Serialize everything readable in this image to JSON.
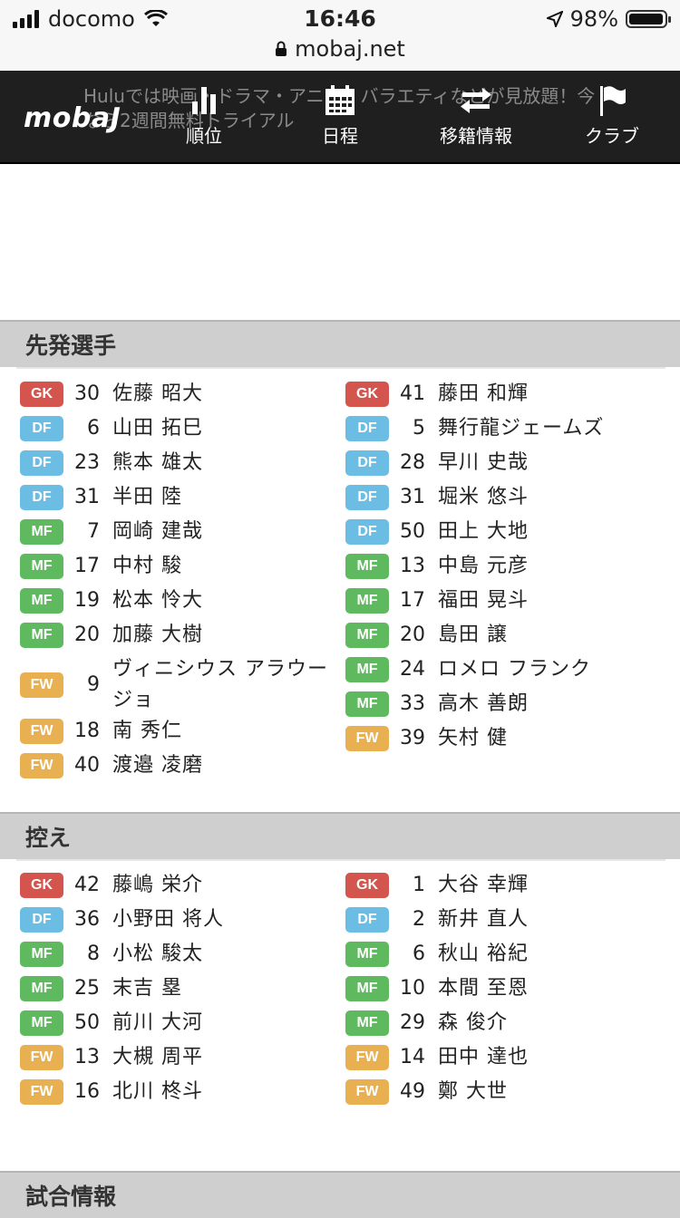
{
  "status_bar": {
    "carrier": "docomo",
    "time": "16:46",
    "battery": "98%",
    "battery_level": 0.98,
    "url": "mobaj.net"
  },
  "nav": {
    "logo": "mobaJ",
    "ghost_ad_line1": "Huluでは映画・ドラマ・アニメ・バラエティなどが見放題！今",
    "ghost_ad_line2": "なら2週間無料トライアル",
    "items": [
      {
        "label": "順位",
        "icon": "bar-chart-icon"
      },
      {
        "label": "日程",
        "icon": "calendar-icon"
      },
      {
        "label": "移籍情報",
        "icon": "transfer-arrows-icon"
      },
      {
        "label": "クラブ",
        "icon": "flag-icon"
      }
    ]
  },
  "position_colors": {
    "GK": "#d3554e",
    "DF": "#6bbde3",
    "MF": "#5fba5f",
    "FW": "#e8b050"
  },
  "starters": {
    "title": "先発選手",
    "left": [
      {
        "pos": "GK",
        "num": "30",
        "name": "佐藤 昭大"
      },
      {
        "pos": "DF",
        "num": "6",
        "name": "山田 拓巳"
      },
      {
        "pos": "DF",
        "num": "23",
        "name": "熊本 雄太"
      },
      {
        "pos": "DF",
        "num": "31",
        "name": "半田 陸"
      },
      {
        "pos": "MF",
        "num": "7",
        "name": "岡崎 建哉"
      },
      {
        "pos": "MF",
        "num": "17",
        "name": "中村 駿"
      },
      {
        "pos": "MF",
        "num": "19",
        "name": "松本 怜大"
      },
      {
        "pos": "MF",
        "num": "20",
        "name": "加藤 大樹"
      },
      {
        "pos": "FW",
        "num": "9",
        "name": "ヴィニシウス アラウージョ"
      },
      {
        "pos": "FW",
        "num": "18",
        "name": "南 秀仁"
      },
      {
        "pos": "FW",
        "num": "40",
        "name": "渡邉 凌磨"
      }
    ],
    "right": [
      {
        "pos": "GK",
        "num": "41",
        "name": "藤田 和輝"
      },
      {
        "pos": "DF",
        "num": "5",
        "name": "舞行龍ジェームズ"
      },
      {
        "pos": "DF",
        "num": "28",
        "name": "早川 史哉"
      },
      {
        "pos": "DF",
        "num": "31",
        "name": "堀米 悠斗"
      },
      {
        "pos": "DF",
        "num": "50",
        "name": "田上 大地"
      },
      {
        "pos": "MF",
        "num": "13",
        "name": "中島 元彦"
      },
      {
        "pos": "MF",
        "num": "17",
        "name": "福田 晃斗"
      },
      {
        "pos": "MF",
        "num": "20",
        "name": "島田 譲"
      },
      {
        "pos": "MF",
        "num": "24",
        "name": "ロメロ フランク"
      },
      {
        "pos": "MF",
        "num": "33",
        "name": "高木 善朗"
      },
      {
        "pos": "FW",
        "num": "39",
        "name": "矢村 健"
      }
    ]
  },
  "subs": {
    "title": "控え",
    "left": [
      {
        "pos": "GK",
        "num": "42",
        "name": "藤嶋 栄介"
      },
      {
        "pos": "DF",
        "num": "36",
        "name": "小野田 将人"
      },
      {
        "pos": "MF",
        "num": "8",
        "name": "小松 駿太"
      },
      {
        "pos": "MF",
        "num": "25",
        "name": "末吉 塁"
      },
      {
        "pos": "MF",
        "num": "50",
        "name": "前川 大河"
      },
      {
        "pos": "FW",
        "num": "13",
        "name": "大槻 周平"
      },
      {
        "pos": "FW",
        "num": "16",
        "name": "北川 柊斗"
      }
    ],
    "right": [
      {
        "pos": "GK",
        "num": "1",
        "name": "大谷 幸輝"
      },
      {
        "pos": "DF",
        "num": "2",
        "name": "新井 直人"
      },
      {
        "pos": "MF",
        "num": "6",
        "name": "秋山 裕紀"
      },
      {
        "pos": "MF",
        "num": "10",
        "name": "本間 至恩"
      },
      {
        "pos": "MF",
        "num": "29",
        "name": "森 俊介"
      },
      {
        "pos": "FW",
        "num": "14",
        "name": "田中 達也"
      },
      {
        "pos": "FW",
        "num": "49",
        "name": "鄭 大世"
      }
    ]
  },
  "match_info": {
    "title": "試合情報"
  }
}
